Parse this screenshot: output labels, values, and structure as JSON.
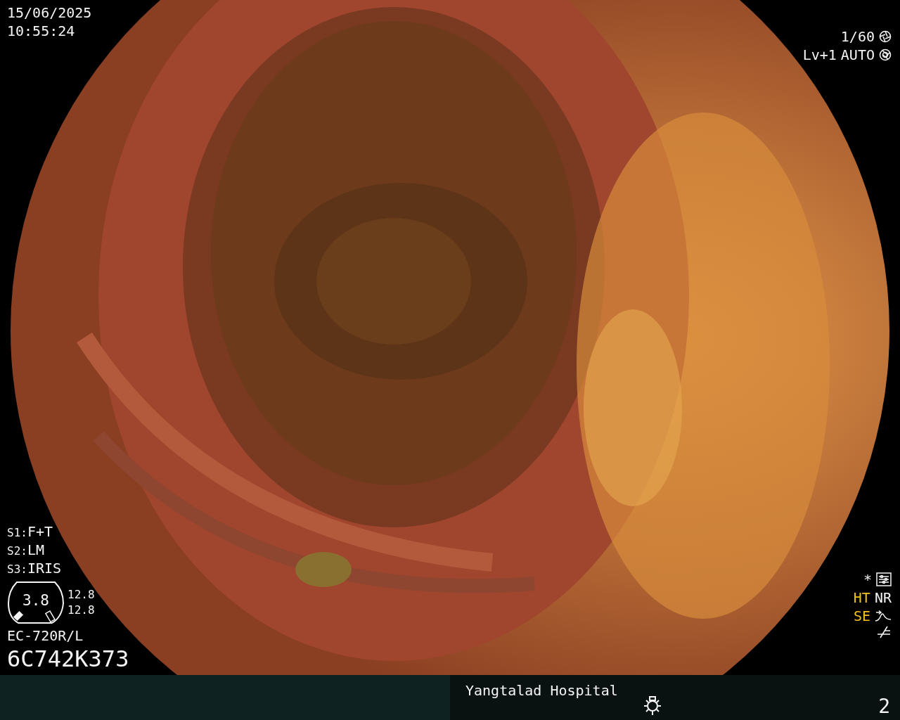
{
  "header": {
    "date": "15/06/2025",
    "time": "10:55:24"
  },
  "exposure": {
    "shutter": "1/60",
    "level": "Lv+1",
    "mode": "AUTO"
  },
  "scope_settings": [
    {
      "key": "S1:",
      "value": "F+T"
    },
    {
      "key": "S2:",
      "value": "LM"
    },
    {
      "key": "S3:",
      "value": "IRIS"
    }
  ],
  "gauge": {
    "reading": "3.8",
    "values": [
      "12.8",
      "12.8"
    ]
  },
  "scope": {
    "model": "EC-720R/L",
    "serial": "6C742K373"
  },
  "processing": {
    "asterisk": "*",
    "indicators": [
      {
        "label": "HT",
        "on": true
      },
      {
        "label": "NR",
        "on": false
      }
    ],
    "enhance": {
      "label": "SE",
      "on": true
    }
  },
  "footer": {
    "hospital": "Yangtalad Hospital",
    "page": "2"
  }
}
